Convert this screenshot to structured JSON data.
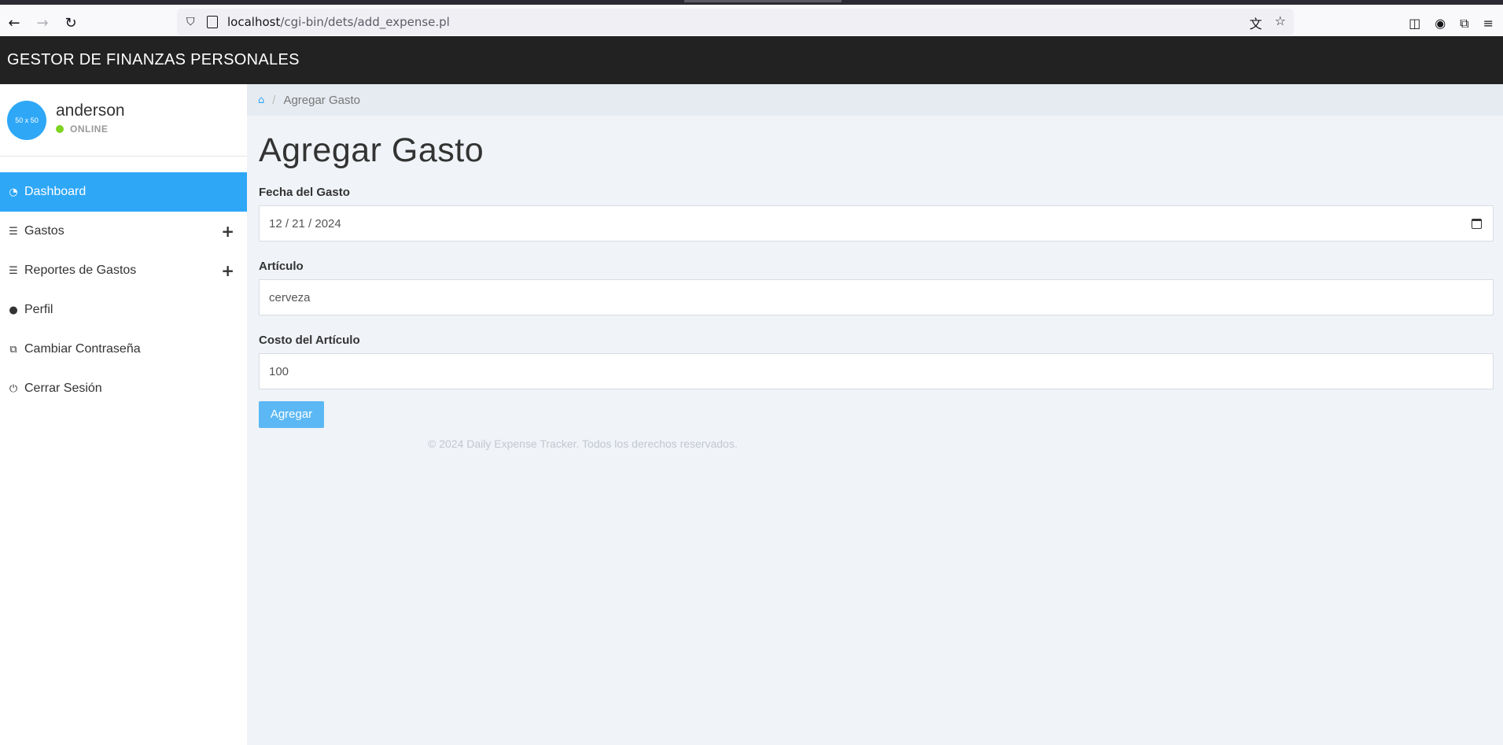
{
  "browser": {
    "url_host": "localhost",
    "url_path": "/cgi-bin/dets/add_expense.pl"
  },
  "header": {
    "title": "GESTOR DE FINANZAS PERSONALES"
  },
  "sidebar": {
    "avatar_text": "50 x 50",
    "user_name": "anderson",
    "status": "ONLINE",
    "items": [
      {
        "label": "Dashboard",
        "icon": "dashboard-icon"
      },
      {
        "label": "Gastos",
        "icon": "bars-icon"
      },
      {
        "label": "Reportes de Gastos",
        "icon": "bars-icon"
      },
      {
        "label": "Perfil",
        "icon": "user-icon"
      },
      {
        "label": "Cambiar Contraseña",
        "icon": "copy-icon"
      },
      {
        "label": "Cerrar Sesión",
        "icon": "power-icon"
      }
    ]
  },
  "breadcrumb": {
    "current": "Agregar Gasto"
  },
  "main": {
    "title": "Agregar Gasto",
    "fields": {
      "date_label": "Fecha del Gasto",
      "date_value": "12 / 21 / 2024",
      "item_label": "Artículo",
      "item_value": "cerveza",
      "cost_label": "Costo del Artículo",
      "cost_value": "100"
    },
    "submit_label": "Agregar",
    "footer": "© 2024 Daily Expense Tracker. Todos los derechos reservados."
  },
  "colors": {
    "accent": "#2ea7f7",
    "header_bg": "#222222",
    "status_online": "#7ed321"
  }
}
